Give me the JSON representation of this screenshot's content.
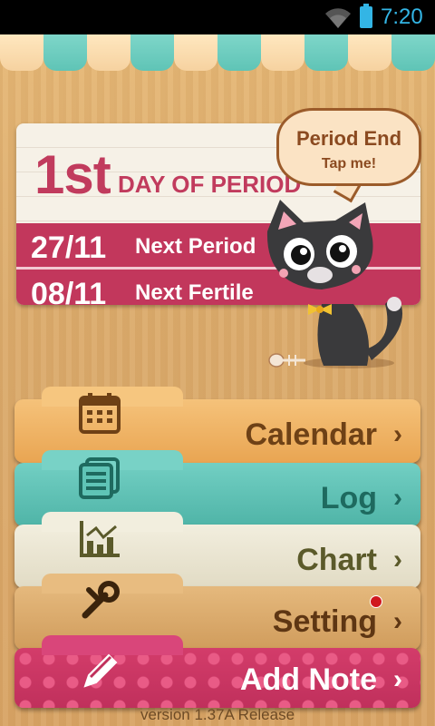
{
  "status_bar": {
    "time": "7:20"
  },
  "info": {
    "day": "1st",
    "day_label": "DAY OF PERIOD",
    "next_period_date": "27/11",
    "next_period_label": "Next Period",
    "next_fertile_date": "08/11",
    "next_fertile_label": "Next Fertile"
  },
  "bubble": {
    "title": "Period End",
    "subtitle": "Tap me!"
  },
  "menu": {
    "calendar": "Calendar",
    "log": "Log",
    "chart": "Chart",
    "setting": "Setting",
    "add_note": "Add Note",
    "chevron": "›"
  },
  "footer": {
    "version": "version 1.37A  Release"
  },
  "colors": {
    "accent": "#c2375c",
    "teal": "#5fc4b6",
    "status": "#33b5e5"
  }
}
